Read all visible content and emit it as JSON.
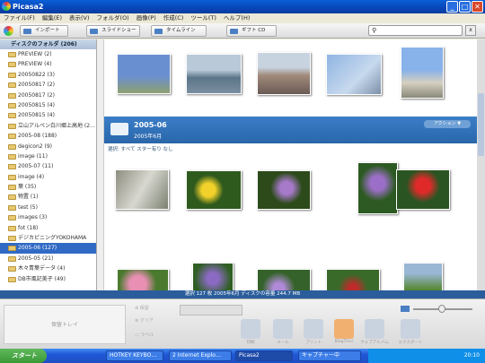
{
  "window": {
    "title": "Picasa2",
    "min": "_",
    "max": "□",
    "close": "✕"
  },
  "menu": [
    "ファイル(F)",
    "編集(E)",
    "表示(V)",
    "フォルダ(O)",
    "画像(P)",
    "作成(C)",
    "ツール(T)",
    "ヘルプ(H)"
  ],
  "toolbar": {
    "import": "インポート",
    "slideshow": "スライドショー",
    "timeline": "タイムライン",
    "giftcd": "ギフト CD"
  },
  "sidebar": {
    "header": "ディスクのフォルダ (206)",
    "items": [
      "PREVIEW (2)",
      "PREVIEW (4)",
      "20050822 (3)",
      "20050817 (2)",
      "20050817 (2)",
      "20050815 (4)",
      "20050815 (4)",
      "立山アルペン白川郷上高地 (2…",
      "2005-08 (188)",
      "degicon2 (9)",
      "image (11)",
      "2005-07 (11)",
      "image (4)",
      "葉 (35)",
      "物置 (1)",
      "test (5)",
      "images (3)",
      "fot (18)",
      "デジカピニングYOKOHAMA",
      "2005-06 (127)",
      "2005-05 (21)",
      "木々青葉データ (4)",
      "DB市風記美子 (49)"
    ]
  },
  "folder": {
    "name": "2005-06",
    "date": "2005年6月",
    "action": "アクション ▼",
    "select": "選択: すべて スター有り なし"
  },
  "status": "選択 127 枚   2005年6月     ディスクの容量 244.7 MB",
  "tray": {
    "hold": "保留トレイ",
    "print": "印刷",
    "email": "メール",
    "order": "プリント",
    "blog": "BlogThis!",
    "upload": "ウェブアルバム",
    "export": "エクスポート"
  },
  "taskbar": {
    "start": "スタート",
    "tasks": [
      "HOTKEY KEYBO…",
      "2 Internet Explo…",
      "Picasa2",
      "キャプチャー中"
    ],
    "clock": "20:10"
  }
}
